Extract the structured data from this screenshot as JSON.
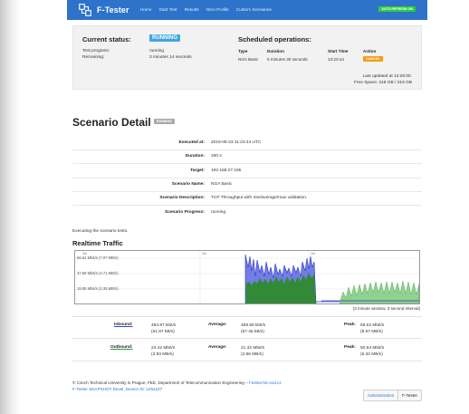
{
  "nav": {
    "brand": "F-Tester",
    "links": [
      "Home",
      "Start Test",
      "Results",
      "NGA Profile",
      "Custom Scenarios"
    ],
    "auto_refresh": "AUTO REFRESH ON"
  },
  "status": {
    "title": "Current status:",
    "state": "RUNNING",
    "progress_label": "Test progress:",
    "progress_value": "running",
    "remaining_label": "Remaining:",
    "remaining_value": "3 minutes 14 seconds"
  },
  "scheduled": {
    "title": "Scheduled operations:",
    "headers": [
      "Type",
      "Duration",
      "Start Time",
      "Action"
    ],
    "row": {
      "type": "NGA Basic",
      "duration": "5 minutes 30 seconds",
      "start": "13:23:44",
      "action": "CANCEL"
    },
    "last_updated": "Last updated at 13:26:00.",
    "free_space": "Free Space: 218 GB / 219 GB"
  },
  "scenario": {
    "title": "Scenario Detail",
    "badge": "RUNNING",
    "rows": [
      {
        "label": "Executed at:",
        "value": "2019-05-23 11:23:44 UTC"
      },
      {
        "label": "Duration:",
        "value": "330 s"
      },
      {
        "label": "Target:",
        "value": "192.168.27.165"
      },
      {
        "label": "Scenario Name:",
        "value": "NGA Basic"
      },
      {
        "label": "Scenario Description:",
        "value": "TCP Throughput with min/average/max validation."
      },
      {
        "label": "Scenario Progress:",
        "value": "running"
      }
    ],
    "exec_note": "Executing the scenario tests."
  },
  "realtime": {
    "title": "Realtime Traffic",
    "y_ticks": [
      "56.54 Mbit/s (7.07 MB/s)",
      "37.69 Mbit/s (4.71 MB/s)",
      "18.85 Mbit/s (2.35 MB/s)"
    ],
    "x_ticks": [
      "3m",
      "2m",
      "1m"
    ],
    "caption": "(3 minute window, 3 second interval)",
    "colors": {
      "inbound": "#5b66e0",
      "inbound_stroke": "#2a35c8",
      "outbound": "#2e8b2e",
      "outbound_light": "#8fd18f"
    }
  },
  "traffic": {
    "inbound": {
      "label": "Inbound:",
      "current": "494.97 kbit/s",
      "current_b": "(61.87 kB/s)",
      "avg_label": "Average:",
      "avg": "459.59 kbit/s",
      "avg_b": "(57.45 kB/s)",
      "peak_label": "Peak:",
      "peak": "68.53 Mbit/s",
      "peak_b": "(8.57 MB/s)"
    },
    "outbound": {
      "label": "Outbound:",
      "current": "23.42 Mbit/s",
      "current_b": "(2.93 MB/s)",
      "avg_label": "Average:",
      "avg": "21.32 Mbit/s",
      "avg_b": "(2.66 MB/s)",
      "peak_label": "Peak:",
      "peak": "50.54 Mbit/s",
      "peak_b": "(6.32 MB/s)"
    }
  },
  "footer": {
    "line1": "© Czech Technical University in Prague, FEE, Department of Telecommunication Engineering – ",
    "link": "f-tester.fel.cvut.cz",
    "line2": "F-Tester SNAPSHOT Devel, Device ID: 1254227",
    "admin": "Administration",
    "ftester": "F-Tester"
  }
}
